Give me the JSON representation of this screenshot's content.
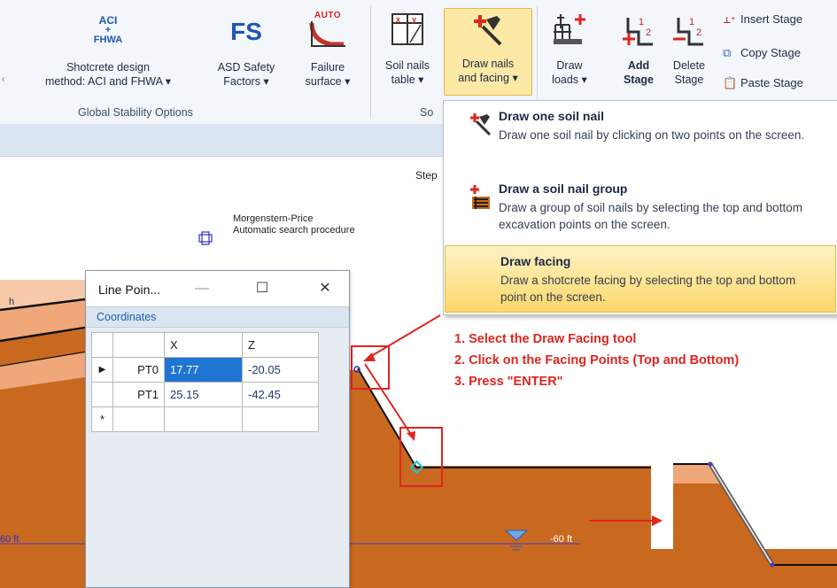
{
  "ribbon": {
    "shotcrete": {
      "icon_text_top": "ACI",
      "icon_text_bottom": "FHWA",
      "label1": "Shotcrete design",
      "label2": "method: ACI and FHWA ▾"
    },
    "asd": {
      "icon_text": "FS",
      "label1": "ASD Safety",
      "label2": "Factors ▾"
    },
    "failure": {
      "icon_text": "AUTO",
      "label1": "Failure",
      "label2": "surface ▾"
    },
    "soil_nails_table": {
      "label1": "Soil nails",
      "label2": "table ▾"
    },
    "draw_nails": {
      "label1": "Draw nails",
      "label2": "and facing ▾"
    },
    "draw_loads": {
      "label1": "Draw",
      "label2": "loads ▾"
    },
    "add_stage": {
      "label1": "Add",
      "label2": "Stage"
    },
    "delete_stage": {
      "label1": "Delete",
      "label2": "Stage"
    },
    "insert_stage": "Insert Stage",
    "copy_stage": "Copy Stage",
    "paste_stage": "Paste Stage",
    "group_global": "Global Stability Options",
    "group_so": "So"
  },
  "dropdown": {
    "items": [
      {
        "title": "Draw one soil nail",
        "desc": "Draw one soil nail by clicking on two points on the screen."
      },
      {
        "title": "Draw a soil nail group",
        "desc": "Draw a group of soil nails by selecting the top and bottom excavation points on the screen."
      },
      {
        "title": "Draw facing",
        "desc": "Draw a shotcrete facing by selecting the top and bottom point on the screen."
      }
    ]
  },
  "canvas": {
    "step_label": "Step",
    "method_line1": "Morgenstern-Price",
    "method_line2": "Automatic search procedure",
    "water_label_left": "60 ft",
    "water_label_right": "-60 ft",
    "layer_label": "h"
  },
  "line_points": {
    "title": "Line Poin...",
    "tab": "Coordinates",
    "col_x": "X",
    "col_z": "Z",
    "rows": [
      {
        "name": "PT0",
        "x": "17.77",
        "z": "-20.05"
      },
      {
        "name": "PT1",
        "x": "25.15",
        "z": "-42.45"
      }
    ],
    "new_row_marker": "*"
  },
  "instructions": [
    "1. Select the Draw Facing tool",
    "2. Click on the Facing Points (Top and Bottom)",
    "3. Press \"ENTER\""
  ],
  "colors": {
    "soil_orange": "#c8691f",
    "soil_light": "#f0a77a",
    "soil_pale": "#f6c9aa",
    "annotation_red": "#e0251f",
    "selection_blue": "#1f76d2"
  }
}
